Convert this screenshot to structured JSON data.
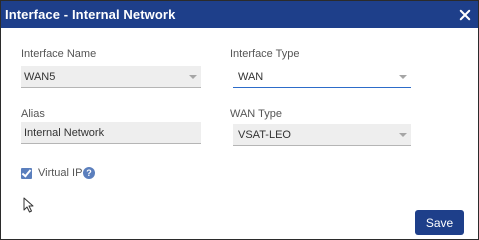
{
  "dialog": {
    "title": "Interface - Internal Network",
    "close_icon": "close-icon"
  },
  "form": {
    "interface_name": {
      "label": "Interface Name",
      "value": "WAN5"
    },
    "interface_type": {
      "label": "Interface Type",
      "value": "WAN"
    },
    "alias": {
      "label": "Alias",
      "value": "Internal Network"
    },
    "wan_type": {
      "label": "WAN Type",
      "value": "VSAT-LEO"
    },
    "virtual_ip": {
      "label": "Virtual IP",
      "checked": true,
      "help_icon": "help-icon"
    }
  },
  "actions": {
    "save_label": "Save"
  },
  "colors": {
    "titlebar": "#1e3f8a",
    "accent": "#2d6cc9",
    "checkbox": "#5b7fbd"
  }
}
